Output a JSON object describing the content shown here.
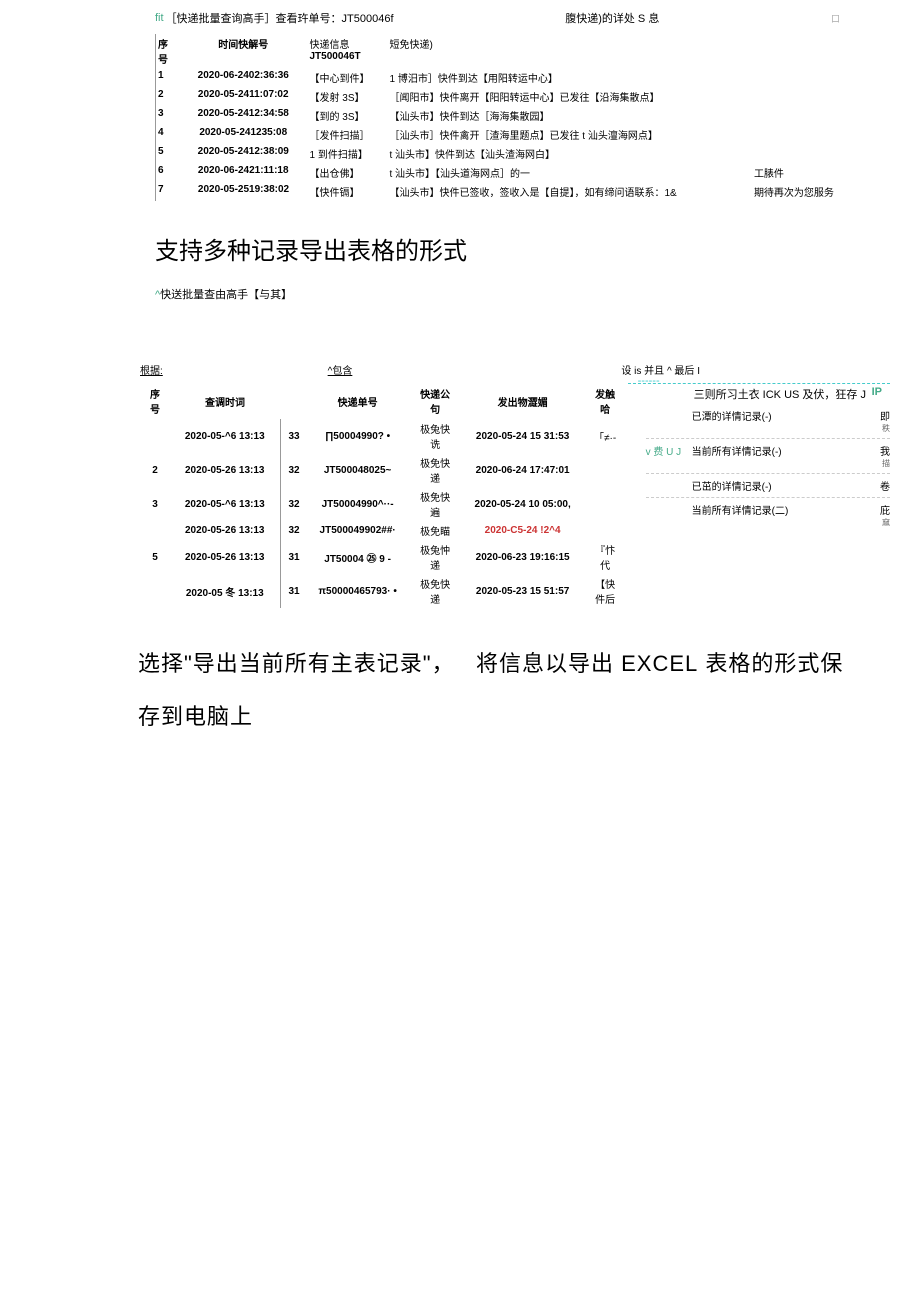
{
  "sec1": {
    "header": {
      "left_green": "fit",
      "left_black": "［快递批量查询高手］查看玝单号：JT500046f",
      "mid": "腹快递)的详处 S 息",
      "right": "口"
    },
    "hdr_row": {
      "idx": "序号",
      "time_label": "时间快解号",
      "info_label": "快递信息",
      "num": "JT500046T",
      "desc": "短免快递)"
    },
    "rows": [
      {
        "idx": "1",
        "time": "2020-06-2402:36:36",
        "tag": "【中心到件】",
        "desc": "1 博汨市］快件到达【用阳转运中心】"
      },
      {
        "idx": "2",
        "time": "2020-05-2411:07:02",
        "tag": "【发射 3S】",
        "desc": "［闻阳市】快件离开【阳阳转运中心】已发往【沿海集散点】"
      },
      {
        "idx": "3",
        "time": "2020-05-2412:34:58",
        "tag": "【到的 3S】",
        "desc": "【汕头市】快件到达［海海集散园】"
      },
      {
        "idx": "4",
        "time": "2020-05-241235:08",
        "tag": "［发件扫描］",
        "desc": "［汕头市］快件禽开［渣海里题点】已发往 t 汕头澶海网点】"
      },
      {
        "idx": "5",
        "time": "2020-05-2412:38:09",
        "tag": "1 到件扫描】",
        "desc": "t 汕头市】快件到达【汕头渣海网白】"
      },
      {
        "idx": "6",
        "time": "2020-06-2421:11:18",
        "tag": "【出仓佛】",
        "desc": "t 汕头市】【汕头道海网点］的一",
        "extra": "工脿件"
      },
      {
        "idx": "7",
        "time": "2020-05-2519:38:02",
        "tag": "【快件镉】",
        "desc": "【汕头市】快件已签收，签收入是【自提】，如有缔问语联系：1&",
        "extra": "期待再次为您服务"
      }
    ]
  },
  "heading1": "支持多种记录导出表格的形式",
  "sub1": {
    "green": "^",
    "text": "快送批量查由高手【与其】"
  },
  "sec2": {
    "top": {
      "a": "根据:",
      "b": "^包含",
      "c": "设 is 并且 ^ 最后 I"
    },
    "thead": [
      "序号",
      "查调时词",
      "",
      "快递单号",
      "快递公句",
      "发出物澀媚",
      "发触哈"
    ],
    "rows": [
      {
        "idx": "",
        "tm": "2020-05-^6 13:13",
        "cd": "33",
        "no": "∏50004990? •",
        "co": "极兔快诜",
        "st": "2020-05-24 15 31:53",
        "ct": "「≠·-"
      },
      {
        "idx": "2",
        "tm": "2020-05-26 13:13",
        "cd": "32",
        "no": "JT500048025~",
        "co": "极免快递",
        "st": "2020-06-24 17:47:01",
        "ct": ""
      },
      {
        "idx": "3",
        "tm": "2020-05-^6 13:13",
        "cd": "32",
        "no": "JT50004990^··-",
        "co": "极免快遍",
        "st": "2020-05-24 10 05:00,",
        "ct": ""
      },
      {
        "idx": "",
        "tm": "2020-05-26 13:13",
        "cd": "32",
        "no": "JT500049902##·",
        "co": "极免瞄",
        "st": "2020-C5-24 !2^4<S4",
        "ct": "",
        "red": true
      },
      {
        "idx": "5",
        "tm": "2020-05-26 13:13",
        "cd": "31",
        "no": "JT50004 ㉕ 9    -",
        "co": "极兔忡递",
        "st": "2020-06-23 19:16:15",
        "ct": "『忭代"
      },
      {
        "idx": "",
        "tm": "2020-05 冬 13:13",
        "cd": "31",
        "no": "π50000465793· •",
        "co": "极免快递",
        "st": "2020-05-23 15 51:57",
        "ct": "【快件后"
      }
    ],
    "menu": {
      "title": "三则所习土衣 ICK US 及伏，狂存 J",
      "ip": "IP",
      "items": [
        {
          "l": "",
          "m": "已潭的详情记录(-)",
          "r": "即",
          "r2": "秩"
        },
        {
          "l": "v 费 U J",
          "m": "当前所有详情记录(-)",
          "r": "我",
          "r2": "描",
          "grn": true
        },
        {
          "l": "",
          "m": "已茁的详情记录(-)",
          "r": "卷",
          "r2": ""
        },
        {
          "l": "",
          "m": "当前所有详情记录(二)",
          "r": "庇",
          "r2": "窳"
        }
      ]
    }
  },
  "body_text": {
    "line1a": "选择\"导出当前所有主表记录\"，",
    "line1b": "将信息以导出 ",
    "line1c": "EXCEL",
    "line1d": " 表格的形式保",
    "line2": "存到电脑上"
  }
}
